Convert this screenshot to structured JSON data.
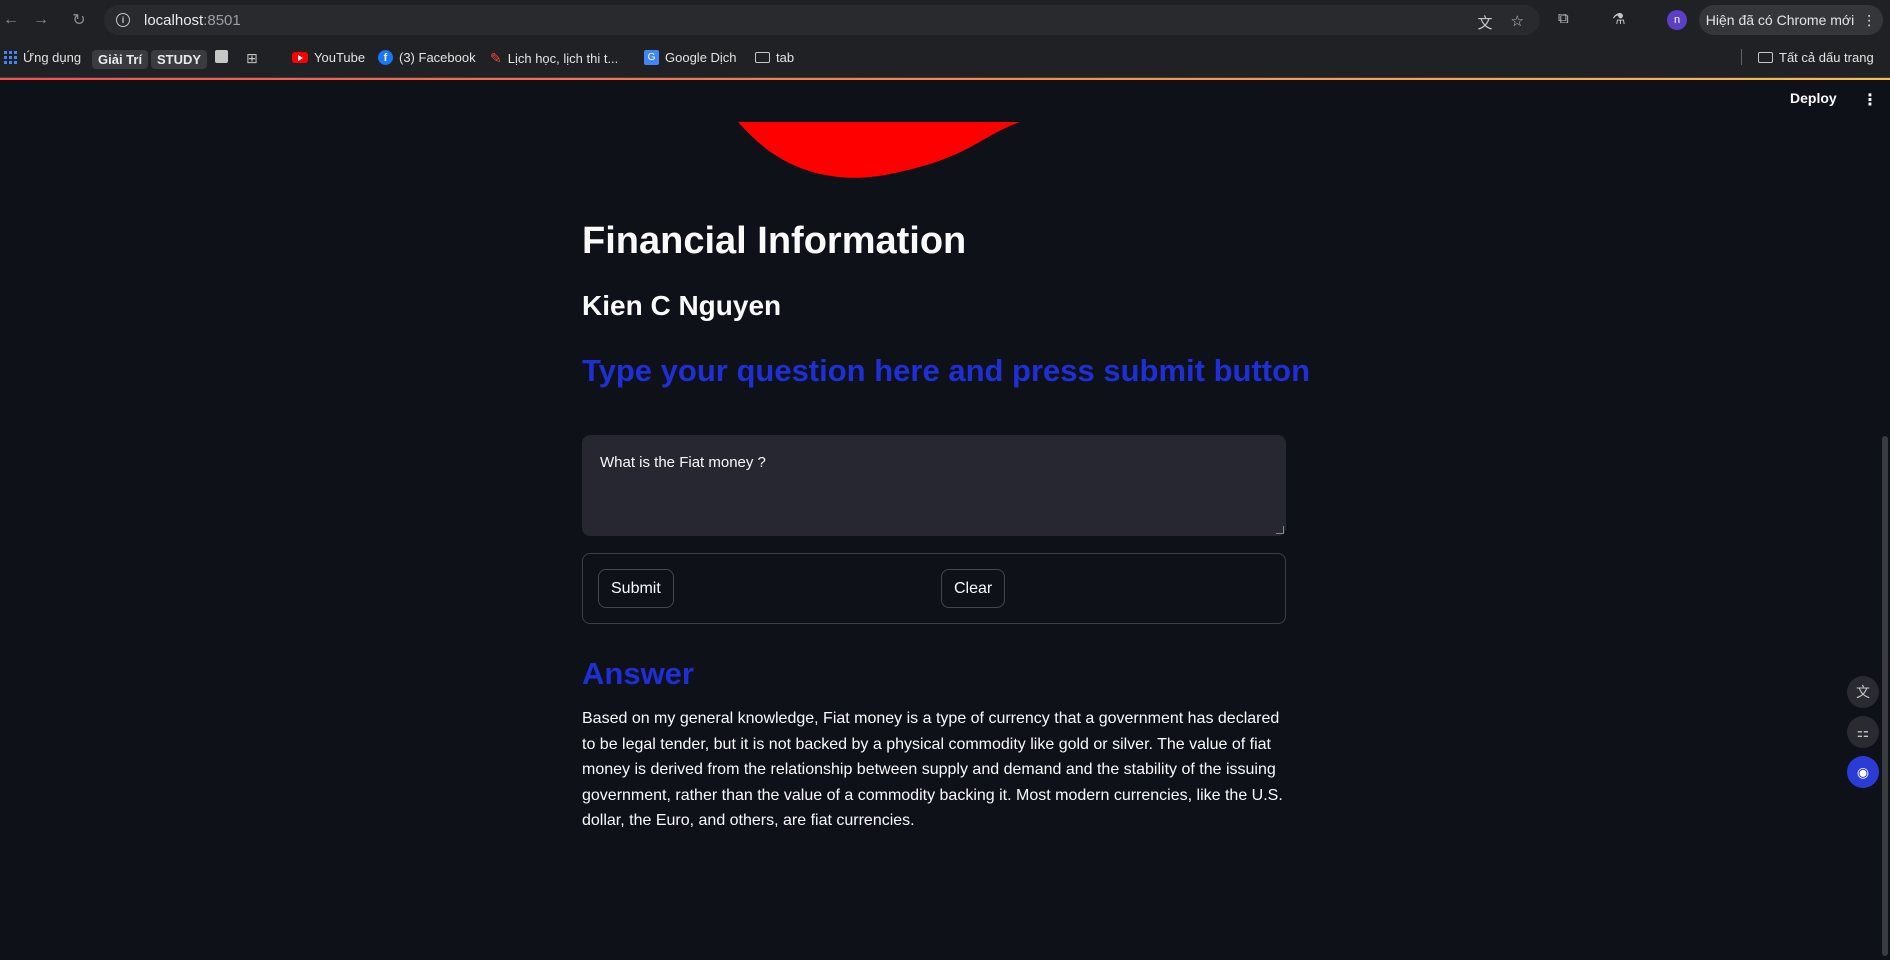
{
  "browser": {
    "url_host": "localhost",
    "url_port": ":8501",
    "chrome_new_label": "Hiện đã có Chrome mới",
    "avatar_letter": "n",
    "all_bookmarks_label": "Tất cả dấu trang"
  },
  "bookmarks": {
    "apps": "Ứng dụng",
    "giaitri": "Giải Trí",
    "study": "STUDY",
    "youtube": "YouTube",
    "facebook": "(3) Facebook",
    "lich": "Lịch học, lịch thi t...",
    "google_dich": "Google Dịch",
    "tab": "tab"
  },
  "toolbar": {
    "deploy_label": "Deploy"
  },
  "page": {
    "title": "Financial Information",
    "author": "Kien C Nguyen",
    "prompt_heading": "Type your question here and press submit button",
    "question_value": "What is the Fiat money ?",
    "submit_label": "Submit",
    "clear_label": "Clear",
    "answer_heading": "Answer",
    "answer_text": "Based on my general knowledge, Fiat money is a type of currency that a government has declared to be legal tender, but it is not backed by a physical commodity like gold or silver. The value of fiat money is derived from the relationship between supply and demand and the stability of the issuing government, rather than the value of a commodity backing it. Most modern currencies, like the U.S. dollar, the Euro, and others, are fiat currencies."
  },
  "colors": {
    "background": "#0e1117",
    "accent_blue": "#1f2fd6",
    "logo_red": "#ff0000"
  }
}
